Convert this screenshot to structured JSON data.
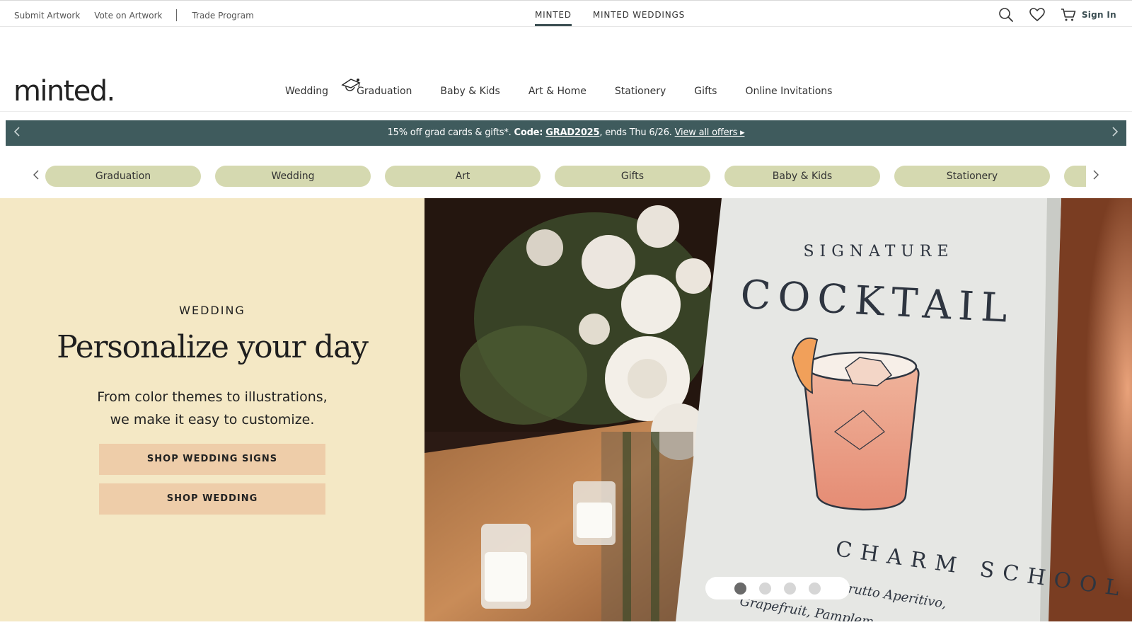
{
  "utility": {
    "left_links": [
      "Submit Artwork",
      "Vote on Artwork",
      "Trade Program"
    ],
    "site_tabs": [
      {
        "label": "MINTED",
        "active": true
      },
      {
        "label": "MINTED WEDDINGS",
        "active": false
      }
    ],
    "icons": [
      "search-icon",
      "heart-icon",
      "cart-icon"
    ],
    "sign_in": "Sign In"
  },
  "logo": "minted.",
  "main_nav": [
    "Wedding",
    "Graduation",
    "Baby & Kids",
    "Art & Home",
    "Stationery",
    "Gifts",
    "Online Invitations"
  ],
  "promo": {
    "lead": "15% off grad cards & gifts*.",
    "code_label": "Code:",
    "code": "GRAD2025",
    "ends": ", ends Thu 6/26.",
    "offers_link": "View all offers ▸",
    "background": "#3f5b5d"
  },
  "category_pills": [
    "Graduation",
    "Wedding",
    "Art",
    "Gifts",
    "Baby & Kids",
    "Stationery"
  ],
  "pill_color": "#d5d9b0",
  "hero": {
    "eyebrow": "WEDDING",
    "title": "Personalize your day",
    "subtitle_line1": "From color themes to illustrations,",
    "subtitle_line2": "we make it easy to customize.",
    "buttons": [
      "SHOP WEDDING SIGNS",
      "SHOP WEDDING"
    ],
    "panel_color": "#f4e8c5",
    "button_color": "#eecda9",
    "sign": {
      "line1": "SIGNATURE",
      "line2": "COCKTAIL",
      "line3": "CHARM SCHOOL",
      "line4": "Brutto Aperitivo,",
      "line5": "Grapefruit, Pamplem"
    },
    "carousel": {
      "slides": 4,
      "active_index": 0
    }
  }
}
